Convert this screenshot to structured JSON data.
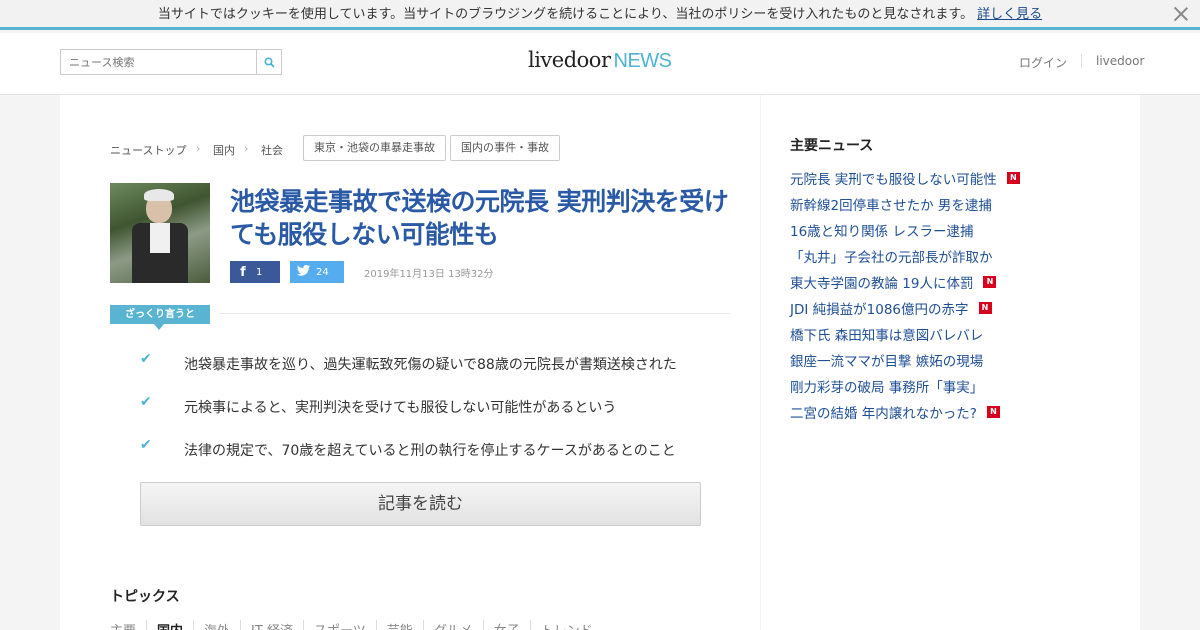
{
  "cookie": {
    "message": "当サイトではクッキーを使用しています。当サイトのブラウジングを続けることにより、当社のポリシーを受け入れたものと見なされます。",
    "link": "詳しく見る"
  },
  "header": {
    "search_placeholder": "ニュース検索",
    "logo_word": "livedoor",
    "logo_news": "NEWS",
    "login": "ログイン",
    "livedoor": "livedoor"
  },
  "breadcrumb": {
    "items": [
      "ニューストップ",
      "国内",
      "社会"
    ],
    "separator": "›"
  },
  "tags": [
    "東京・池袋の車暴走事故",
    "国内の事件・事故"
  ],
  "article": {
    "title": "池袋暴走事故で送検の元院長 実刑判決を受けても服役しない可能性も",
    "facebook_count": "1",
    "twitter_count": "24",
    "date": "2019年11月13日 13時32分",
    "summary_label": "ざっくり言うと",
    "summary": [
      "池袋暴走事故を巡り、過失運転致死傷の疑いで88歳の元院長が書類送検された",
      "元検事によると、実刑判決を受けても服役しない可能性があるという",
      "法律の規定で、70歳を超えていると刑の執行を停止するケースがあるとのこと"
    ],
    "read_button": "記事を読む"
  },
  "topics": {
    "heading": "トピックス",
    "tabs": [
      "主要",
      "国内",
      "海外",
      "IT 経済",
      "スポーツ",
      "芸能",
      "グルメ",
      "女子",
      "トレンド"
    ],
    "active": "国内"
  },
  "sidebar": {
    "heading": "主要ニュース",
    "news_badge": "N",
    "items": [
      {
        "text": "元院長 実刑でも服役しない可能性",
        "new": true
      },
      {
        "text": "新幹線2回停車させたか 男を逮捕",
        "new": false
      },
      {
        "text": "16歳と知り関係 レスラー逮捕",
        "new": false
      },
      {
        "text": "「丸井」子会社の元部長が詐取か",
        "new": false
      },
      {
        "text": "東大寺学園の教論 19人に体罰",
        "new": true
      },
      {
        "text": "JDI 純損益が1086億円の赤字",
        "new": true
      },
      {
        "text": "橋下氏 森田知事は意図バレバレ",
        "new": false
      },
      {
        "text": "銀座一流ママが目撃 嫉妬の現場",
        "new": false
      },
      {
        "text": "剛力彩芽の破局 事務所「事実」",
        "new": false
      },
      {
        "text": "二宮の結婚 年内譲れなかった?",
        "new": true
      }
    ]
  },
  "colors": {
    "accent": "#58b4d1",
    "title_blue": "#2a5aa5",
    "link_blue": "#1f4f95",
    "facebook": "#3b5998",
    "twitter": "#55acee",
    "new_badge": "#d7001d"
  }
}
